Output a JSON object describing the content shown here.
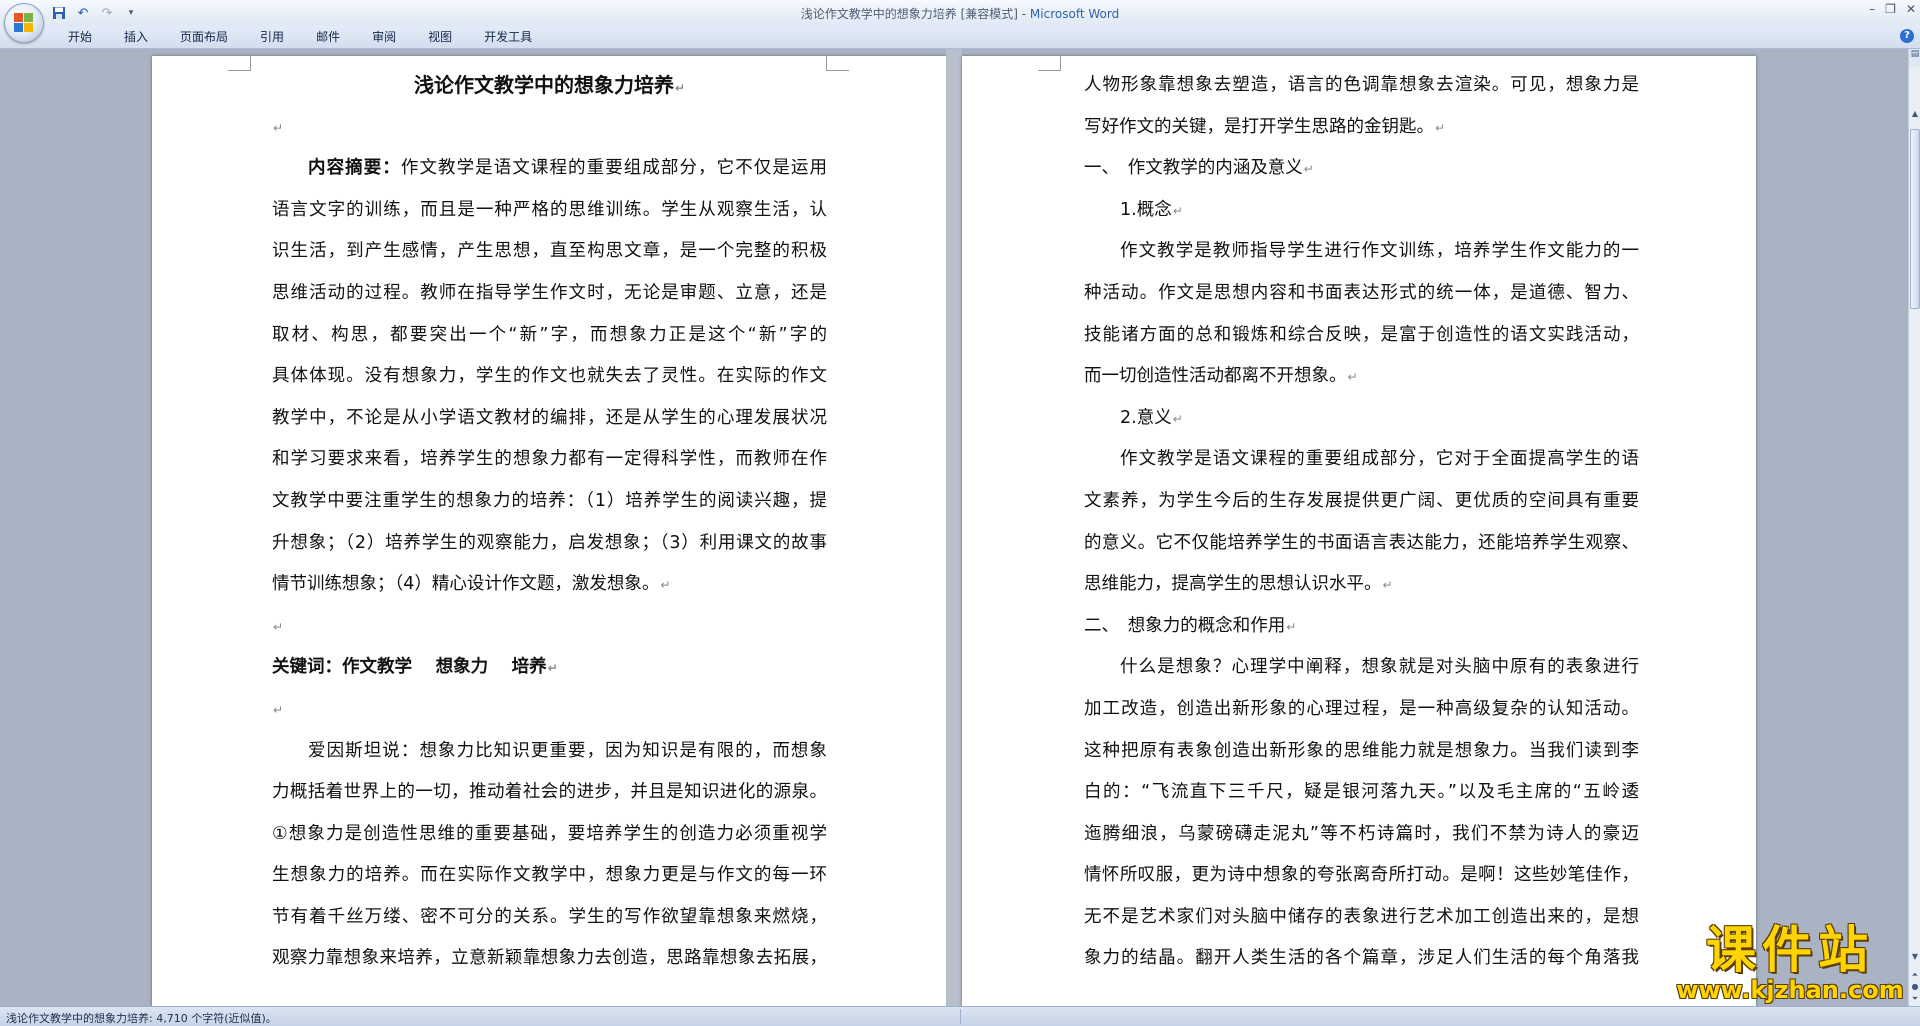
{
  "window": {
    "title": "浅论作文教学中的想象力培养 [兼容模式] - ",
    "app_name": "Microsoft Word",
    "minimize": "–",
    "restore": "❐",
    "close": "✕"
  },
  "quick_access": {
    "save_icon": "floppy-icon",
    "undo_glyph": "↶",
    "redo_glyph": "↷",
    "customize_glyph": "▾"
  },
  "ribbon_tabs": [
    "开始",
    "插入",
    "页面布局",
    "引用",
    "邮件",
    "审阅",
    "视图",
    "开发工具"
  ],
  "help_glyph": "?",
  "paragraph_mark": "↵",
  "left_page": {
    "title": "浅论作文教学中的想象力培养",
    "abstract_label": "内容摘要：",
    "abstract_first": "作文教学是语文课程的重要组成部分，它不仅是运用",
    "abstract_lines": [
      "语言文字的训练，而且是一种严格的思维训练。学生从观察生活，认",
      "识生活，到产生感情，产生思想，直至构思文章，是一个完整的积极",
      "思维活动的过程。教师在指导学生作文时，无论是审题、立意，还是",
      "取材、构思，都要突出一个“新”字，而想象力正是这个“新”字的",
      "具体体现。没有想象力，学生的作文也就失去了灵性。在实际的作文",
      "教学中，不论是从小学语文教材的编排，还是从学生的心理发展状况",
      "和学习要求来看，培养学生的想象力都有一定得科学性，而教师在作",
      "文教学中要注重学生的想象力的培养：（1）培养学生的阅读兴趣，提",
      "升想象；（2）培养学生的观察能力，启发想象；（3）利用课文的故事"
    ],
    "abstract_last": "情节训练想象；（4）精心设计作文题，激发想象。",
    "keywords": "关键词：作文教学　 想象力　 培养",
    "body_first": "爱因斯坦说：想象力比知识更重要，因为知识是有限的，而想象",
    "body_lines": [
      "力概括着世界上的一切，推动着社会的进步，并且是知识进化的源泉。",
      "①想象力是创造性思维的重要基础，要培养学生的创造力必须重视学",
      "生想象力的培养。而在实际作文教学中，想象力更是与作文的每一环",
      "节有着千丝万缕、密不可分的关系。学生的写作欲望靠想象来燃烧，",
      "观察力靠想象来培养，立意新颖靠想象力去创造，思路靠想象去拓展，"
    ]
  },
  "right_page": {
    "l1": "人物形象靠想象去塑造，语言的色调靠想象去渲染。可见，想象力是",
    "l2": "写好作文的关键，是打开学生思路的金钥匙。",
    "h1": "一、　作文教学的内涵及意义",
    "s1": "1.概念",
    "p1_first": "作文教学是教师指导学生进行作文训练，培养学生作文能力的一",
    "p1_lines": [
      "种活动。作文是思想内容和书面表达形式的统一体，是道德、智力、",
      "技能诸方面的总和锻炼和综合反映，是富于创造性的语文实践活动，"
    ],
    "p1_last": "而一切创造性活动都离不开想象。",
    "s2": "2.意义",
    "p2_first": "作文教学是语文课程的重要组成部分，它对于全面提高学生的语",
    "p2_lines": [
      "文素养，为学生今后的生存发展提供更广阔、更优质的空间具有重要",
      "的意义。它不仅能培养学生的书面语言表达能力，还能培养学生观察、"
    ],
    "p2_last": "思维能力，提高学生的思想认识水平。",
    "h2": "二、　想象力的概念和作用",
    "p3_first": "什么是想象？心理学中阐释，想象就是对头脑中原有的表象进行",
    "p3_lines": [
      "加工改造，创造出新形象的心理过程，是一种高级复杂的认知活动。",
      "这种把原有表象创造出新形象的思维能力就是想象力。当我们读到李",
      "白的：“飞流直下三千尺，疑是银河落九天。”以及毛主席的“五岭逶",
      "迤腾细浪，乌蒙磅礴走泥丸”等不朽诗篇时，我们不禁为诗人的豪迈",
      "情怀所叹服，更为诗中想象的夸张离奇所打动。是啊！这些妙笔佳作，",
      "无不是艺术家们对头脑中储存的表象进行艺术加工创造出来的，是想",
      "象力的结晶。翻开人类生活的各个篇章，涉足人们生活的每个角落我"
    ]
  },
  "status": {
    "text": "浅论作文教学中的想象力培养: 4,710 个字符(近似值)。"
  },
  "watermark": {
    "title": "课件站",
    "url": "www.kjzhan.com"
  },
  "colors": {
    "app_name": "#2f5fb3",
    "watermark": "#ffd400"
  }
}
